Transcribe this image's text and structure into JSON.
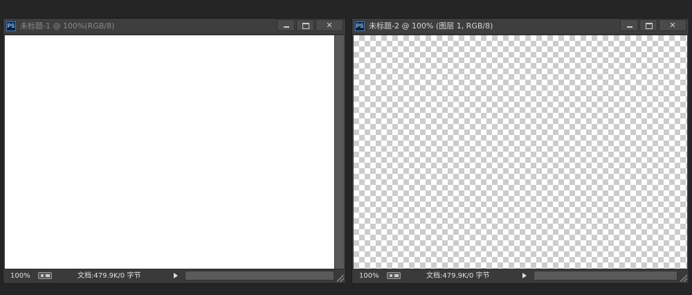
{
  "windows": [
    {
      "app_icon": "PS",
      "title": "未标题-1 @ 100%(RGB/8)",
      "controls": {
        "close": "✕"
      },
      "canvas": {
        "background": "white"
      },
      "status": {
        "zoom": "100%",
        "doc_info": "文档:479.9K/0 字节"
      }
    },
    {
      "app_icon": "PS",
      "title": "未标题-2 @ 100% (图层 1, RGB/8)",
      "controls": {
        "close": "✕"
      },
      "canvas": {
        "background": "transparent-checkerboard"
      },
      "status": {
        "zoom": "100%",
        "doc_info": "文档:479.9K/0 字节"
      }
    }
  ],
  "colors": {
    "workspace": "#252525",
    "window_frame": "#3c3c3c",
    "active_title_text": "#d8d8d8",
    "inactive_title_text": "#8a8a8a",
    "checker_light": "#ffffff",
    "checker_dark": "#cccccc"
  }
}
